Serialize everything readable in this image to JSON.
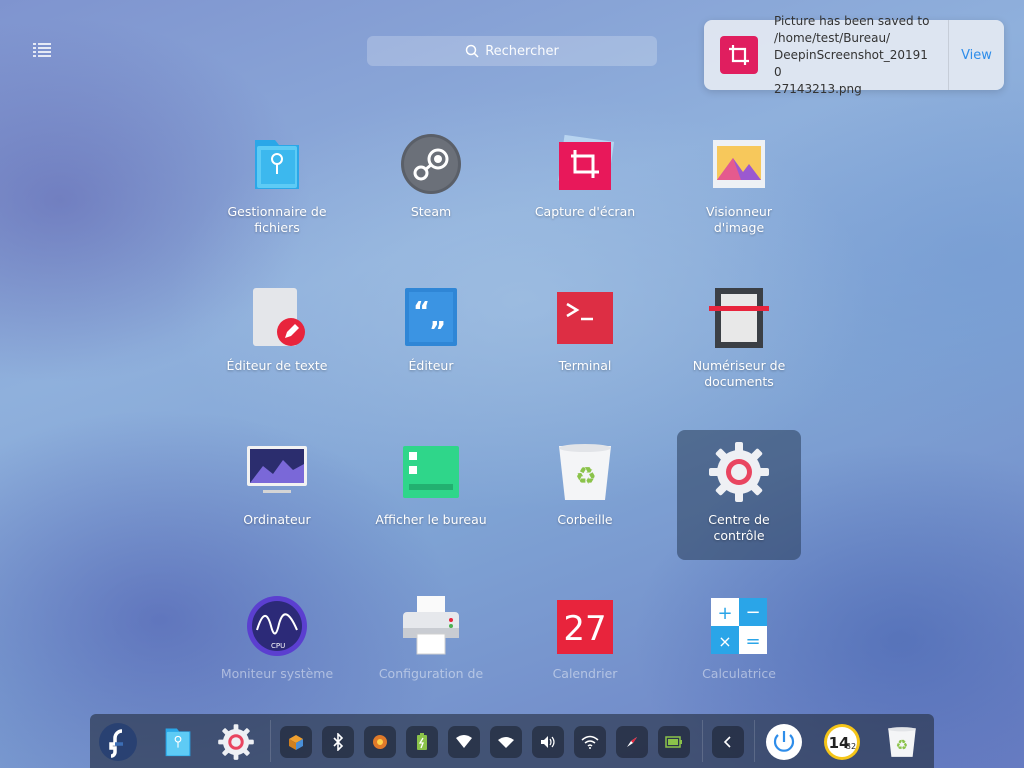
{
  "search": {
    "placeholder": "Rechercher"
  },
  "notification": {
    "line1": "Picture has been saved to",
    "line2": "/home/test/Bureau/",
    "line3": "DeepinScreenshot_201910",
    "line4": "27143213.png",
    "action": "View"
  },
  "apps": [
    {
      "label": "Gestionnaire de fichiers",
      "icon": "file-manager-icon"
    },
    {
      "label": "Steam",
      "icon": "steam-icon"
    },
    {
      "label": "Capture d'écran",
      "icon": "screenshot-icon"
    },
    {
      "label": "Visionneur d'image",
      "icon": "image-viewer-icon"
    },
    {
      "label": "Éditeur de texte",
      "icon": "text-editor-icon"
    },
    {
      "label": "Éditeur",
      "icon": "editor-icon"
    },
    {
      "label": "Terminal",
      "icon": "terminal-icon"
    },
    {
      "label": "Numériseur de documents",
      "icon": "scanner-icon"
    },
    {
      "label": "Ordinateur",
      "icon": "computer-icon"
    },
    {
      "label": "Afficher le bureau",
      "icon": "show-desktop-icon"
    },
    {
      "label": "Corbeille",
      "icon": "trash-icon"
    },
    {
      "label": "Centre de contrôle",
      "icon": "control-center-icon"
    },
    {
      "label": "Moniteur système",
      "icon": "system-monitor-icon"
    },
    {
      "label": "Configuration de",
      "icon": "printer-icon"
    },
    {
      "label": "Calendrier",
      "icon": "calendar-icon"
    },
    {
      "label": "Calculatrice",
      "icon": "calculator-icon"
    }
  ],
  "calendar_day": "27",
  "dock": {
    "clock_hour": "14",
    "clock_minute": "32",
    "colors": {
      "accent": "#2e8dea",
      "brand_red": "#e01e5f"
    }
  }
}
